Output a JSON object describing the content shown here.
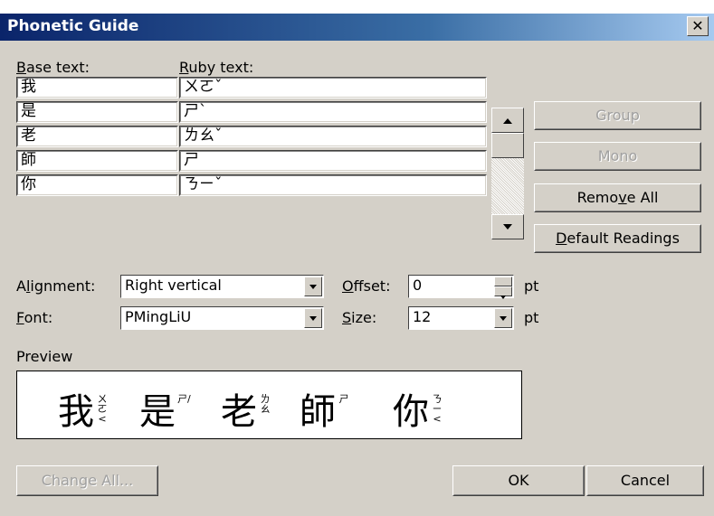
{
  "top_text_cutoff": "",
  "window": {
    "title": "Phonetic Guide"
  },
  "labels": {
    "base_text": "Base text:",
    "ruby_text": "Ruby text:",
    "alignment": "Alignment:",
    "font": "Font:",
    "offset": "Offset:",
    "size": "Size:",
    "pt1": "pt",
    "pt2": "pt",
    "preview": "Preview"
  },
  "rows": [
    {
      "base": "我",
      "ruby": "ㄨㄛˇ"
    },
    {
      "base": "是",
      "ruby": "ㄕˋ"
    },
    {
      "base": "老",
      "ruby": "ㄌㄠˇ"
    },
    {
      "base": "師",
      "ruby": "ㄕ"
    },
    {
      "base": "你",
      "ruby": "ㄋㄧˇ"
    }
  ],
  "buttons": {
    "group": "Group",
    "mono": "Mono",
    "remove_all": "Remove All",
    "default_readings": "Default Readings",
    "change_all": "Change All...",
    "ok": "OK",
    "cancel": "Cancel"
  },
  "fields": {
    "alignment_value": "Right vertical",
    "font_value": "PMingLiU",
    "offset_value": "0",
    "size_value": "12"
  },
  "preview": {
    "segments": [
      {
        "base": "我",
        "ruby": "ㄨㄛ<"
      },
      {
        "base": "是",
        "ruby": "ㄕ/"
      },
      {
        "base": "老",
        "ruby": "ㄌㄠ"
      },
      {
        "base": "師",
        "ruby": "ㄕ"
      },
      {
        "base": "你",
        "ruby": "ㄋㄧ<"
      }
    ]
  },
  "icons": {
    "close": "close-icon",
    "scroll_up": "arrow-up-icon",
    "scroll_down": "arrow-down-icon",
    "dropdown": "chevron-down-icon",
    "spin": "spinner-icon"
  },
  "colors": {
    "titlebar_start": "#0a246a",
    "titlebar_end": "#a6caf0",
    "dialog_bg": "#d4d0c8"
  }
}
